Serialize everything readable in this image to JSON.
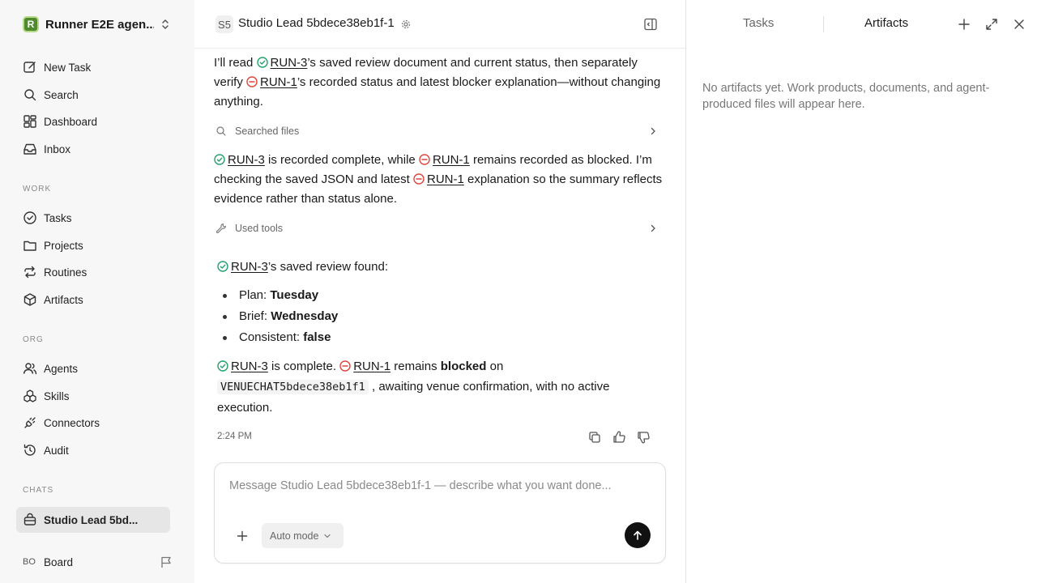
{
  "workspace": {
    "logo_letter": "R",
    "name": "Runner E2E agen..."
  },
  "nav": {
    "new_task": "New Task",
    "search": "Search",
    "dashboard": "Dashboard",
    "inbox": "Inbox"
  },
  "sections": {
    "work": "WORK",
    "org": "ORG",
    "chats": "CHATS"
  },
  "work_items": {
    "tasks": "Tasks",
    "projects": "Projects",
    "routines": "Routines",
    "artifacts": "Artifacts"
  },
  "org_items": {
    "agents": "Agents",
    "skills": "Skills",
    "connectors": "Connectors",
    "audit": "Audit"
  },
  "chats": {
    "active": "Studio Lead 5bd..."
  },
  "user": {
    "initials": "BO",
    "name": "Board"
  },
  "chat": {
    "badge": "S5",
    "title": "Studio Lead 5bdece38eb1f-1",
    "msg1": {
      "a": "I’ll read ",
      "ref1": "RUN-3",
      "b": "’s saved review document and current status, then separately verify ",
      "ref2": "RUN-1",
      "c": "’s recorded status and latest blocker explanation—without changing anything."
    },
    "tool1": "Searched files",
    "msg2": {
      "ref1": "RUN-3",
      "a": " is recorded complete, while ",
      "ref2": "RUN-1",
      "b": " remains recorded as blocked. I’m checking the saved JSON and latest ",
      "ref3": "RUN-1",
      "c": " explanation so the summary reflects evidence rather than status alone."
    },
    "tool2": "Used tools",
    "msg3": {
      "ref1": "RUN-3",
      "a": "’s saved review found:"
    },
    "bullets": [
      {
        "label": "Plan: ",
        "value": "Tuesday"
      },
      {
        "label": "Brief: ",
        "value": "Wednesday"
      },
      {
        "label": "Consistent: ",
        "value": "false"
      }
    ],
    "msg4": {
      "ref1": "RUN-3",
      "a": " is complete. ",
      "ref2": "RUN-1",
      "b": " remains ",
      "bold": "blocked",
      "c": " on ",
      "code": "VENUECHAT5bdece38eb1f1",
      "d": " , awaiting venue confirmation, with no active execution."
    },
    "timestamp": "2:24 PM",
    "composer": {
      "placeholder": "Message Studio Lead 5bdece38eb1f-1 — describe what you want done...",
      "mode": "Auto mode"
    }
  },
  "panel": {
    "tab_tasks": "Tasks",
    "tab_artifacts": "Artifacts",
    "empty": "No artifacts yet. Work products, documents, and agent-produced files will appear here."
  },
  "colors": {
    "done": "#22a06b",
    "blocked": "#e0443e",
    "accent": "#111111"
  }
}
